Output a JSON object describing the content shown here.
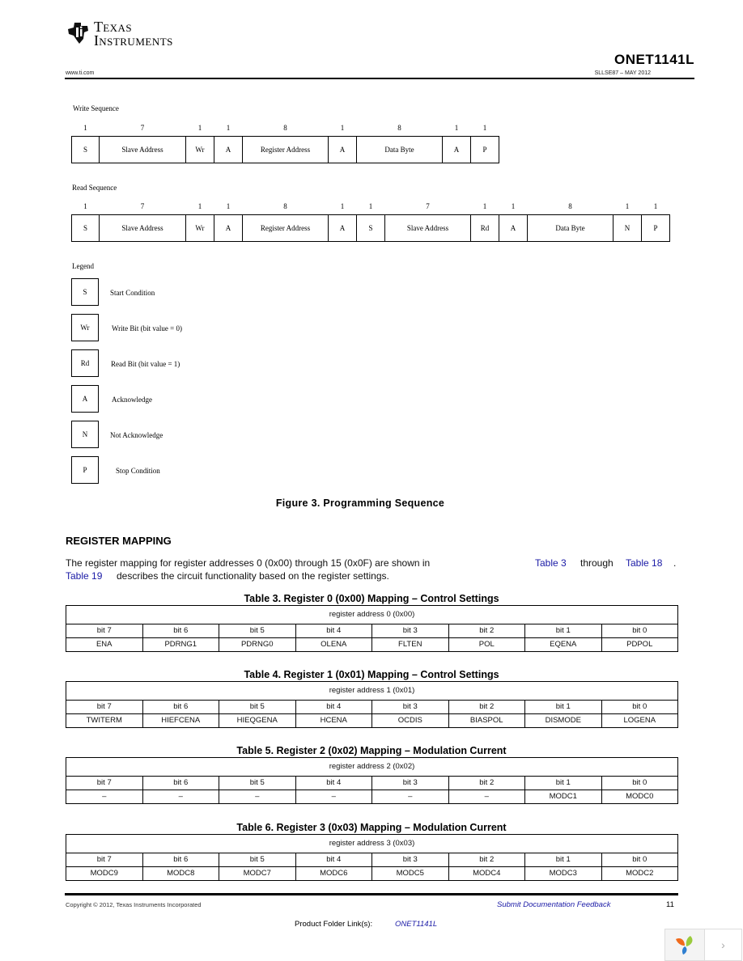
{
  "header": {
    "company_line1": "Texas",
    "company_line2": "Instruments",
    "doc_id": "ONET1141L",
    "website": "www.ti.com",
    "literature": "SLLSE87 – MAY 2012"
  },
  "figure": {
    "write_sequence": {
      "title": "Write Sequence",
      "fields": [
        {
          "bits": "1",
          "label": "S"
        },
        {
          "bits": "7",
          "label": "Slave Address"
        },
        {
          "bits": "1",
          "label": "Wr"
        },
        {
          "bits": "1",
          "label": "A"
        },
        {
          "bits": "8",
          "label": "Register Address"
        },
        {
          "bits": "1",
          "label": "A"
        },
        {
          "bits": "8",
          "label": "Data Byte"
        },
        {
          "bits": "1",
          "label": "A"
        },
        {
          "bits": "1",
          "label": "P"
        }
      ]
    },
    "read_sequence": {
      "title": "Read Sequence",
      "fields": [
        {
          "bits": "1",
          "label": "S"
        },
        {
          "bits": "7",
          "label": "Slave Address"
        },
        {
          "bits": "1",
          "label": "Wr"
        },
        {
          "bits": "1",
          "label": "A"
        },
        {
          "bits": "8",
          "label": "Register Address"
        },
        {
          "bits": "1",
          "label": "A"
        },
        {
          "bits": "1",
          "label": "S"
        },
        {
          "bits": "7",
          "label": "Slave Address"
        },
        {
          "bits": "1",
          "label": "Rd"
        },
        {
          "bits": "1",
          "label": "A"
        },
        {
          "bits": "8",
          "label": "Data Byte"
        },
        {
          "bits": "1",
          "label": "N"
        },
        {
          "bits": "1",
          "label": "P"
        }
      ]
    },
    "legend": {
      "title": "Legend",
      "items": [
        {
          "symbol": "S",
          "label": "Start Condition"
        },
        {
          "symbol": "Wr",
          "label": "Write Bit (bit value = 0)"
        },
        {
          "symbol": "Rd",
          "label": "Read Bit (bit value = 1)"
        },
        {
          "symbol": "A",
          "label": "Acknowledge"
        },
        {
          "symbol": "N",
          "label": "Not Acknowledge"
        },
        {
          "symbol": "P",
          "label": "Stop Condition"
        }
      ]
    },
    "caption": "Figure 3. Programming Sequence"
  },
  "section": {
    "title": "REGISTER MAPPING",
    "para_line1_text": "The register mapping for register addresses 0 (0x00) through 15 (0x0F) are shown in",
    "link_table3": "Table 3",
    "through": "through",
    "link_table18": "Table 18",
    "period": ".",
    "link_table19": "Table 19",
    "para_line2_text": "describes the circuit functionality based on the register settings."
  },
  "tables": [
    {
      "caption": "Table 3. Register 0 (0x00) Mapping – Control Settings",
      "address": "register address 0 (0x00)",
      "bits": [
        "bit 7",
        "bit 6",
        "bit 5",
        "bit 4",
        "bit 3",
        "bit 2",
        "bit 1",
        "bit 0"
      ],
      "values": [
        "ENA",
        "PDRNG1",
        "PDRNG0",
        "OLENA",
        "FLTEN",
        "POL",
        "EQENA",
        "PDPOL"
      ]
    },
    {
      "caption": "Table 4. Register 1 (0x01) Mapping – Control Settings",
      "address": "register address 1 (0x01)",
      "bits": [
        "bit 7",
        "bit 6",
        "bit 5",
        "bit 4",
        "bit 3",
        "bit 2",
        "bit 1",
        "bit 0"
      ],
      "values": [
        "TWITERM",
        "HIEFCENA",
        "HIEQGENA",
        "HCENA",
        "OCDIS",
        "BIASPOL",
        "DISMODE",
        "LOGENA"
      ]
    },
    {
      "caption": "Table 5. Register 2 (0x02) Mapping – Modulation Current",
      "address": "register address 2 (0x02)",
      "bits": [
        "bit 7",
        "bit 6",
        "bit 5",
        "bit 4",
        "bit 3",
        "bit 2",
        "bit 1",
        "bit 0"
      ],
      "values": [
        "–",
        "–",
        "–",
        "–",
        "–",
        "–",
        "MODC1",
        "MODC0"
      ]
    },
    {
      "caption": "Table 6. Register 3 (0x03) Mapping – Modulation Current",
      "address": "register address 3 (0x03)",
      "bits": [
        "bit 7",
        "bit 6",
        "bit 5",
        "bit 4",
        "bit 3",
        "bit 2",
        "bit 1",
        "bit 0"
      ],
      "values": [
        "MODC9",
        "MODC8",
        "MODC7",
        "MODC6",
        "MODC5",
        "MODC4",
        "MODC3",
        "MODC2"
      ]
    }
  ],
  "footer": {
    "copyright": "Copyright © 2012, Texas Instruments Incorporated",
    "feedback_link": "Submit Documentation Feedback",
    "page_number": "11",
    "product_folder_label": "Product Folder Link(s):",
    "product_folder_link": "ONET1141L"
  },
  "viewer_widget": {
    "logo_icon": "flower-logo-icon",
    "next_icon": "chevron-right-icon",
    "next_glyph": "›"
  }
}
